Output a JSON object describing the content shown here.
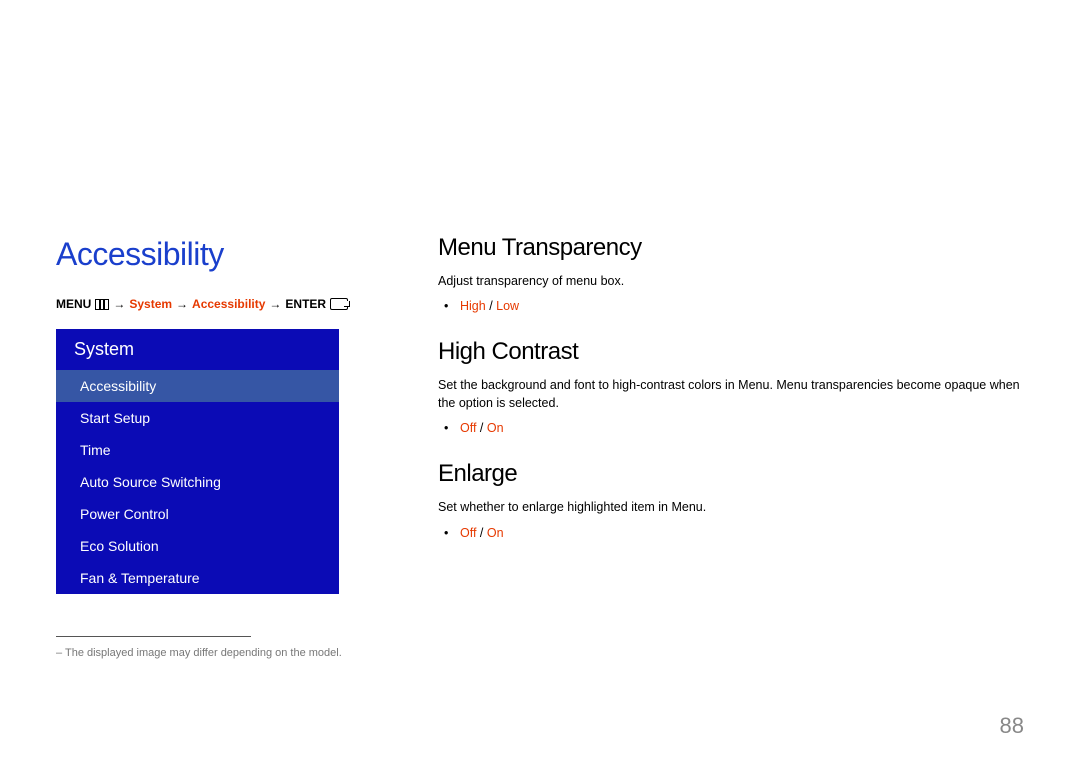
{
  "page_number": "88",
  "left": {
    "heading": "Accessibility",
    "breadcrumb": {
      "menu": "MENU",
      "arrow": "→",
      "system": "System",
      "accessibility": "Accessibility",
      "enter": "ENTER"
    },
    "menu": {
      "header": "System",
      "items": [
        {
          "label": "Accessibility",
          "selected": true
        },
        {
          "label": "Start Setup",
          "selected": false
        },
        {
          "label": "Time",
          "selected": false
        },
        {
          "label": "Auto Source Switching",
          "selected": false
        },
        {
          "label": "Power Control",
          "selected": false
        },
        {
          "label": "Eco Solution",
          "selected": false
        },
        {
          "label": "Fan & Temperature",
          "selected": false
        }
      ]
    },
    "footnote_prefix": "–",
    "footnote": "The displayed image may differ depending on the model."
  },
  "right": {
    "sections": [
      {
        "heading": "Menu Transparency",
        "desc": "Adjust transparency of menu box.",
        "options": [
          {
            "a": "High",
            "sep": " / ",
            "b": "Low"
          }
        ]
      },
      {
        "heading": "High Contrast",
        "desc": "Set the background and font to high-contrast colors in Menu. Menu transparencies become opaque when the option is selected.",
        "options": [
          {
            "a": "Off",
            "sep": " / ",
            "b": "On"
          }
        ]
      },
      {
        "heading": "Enlarge",
        "desc": "Set whether to enlarge highlighted item in Menu.",
        "options": [
          {
            "a": "Off",
            "sep": " / ",
            "b": "On"
          }
        ]
      }
    ]
  }
}
